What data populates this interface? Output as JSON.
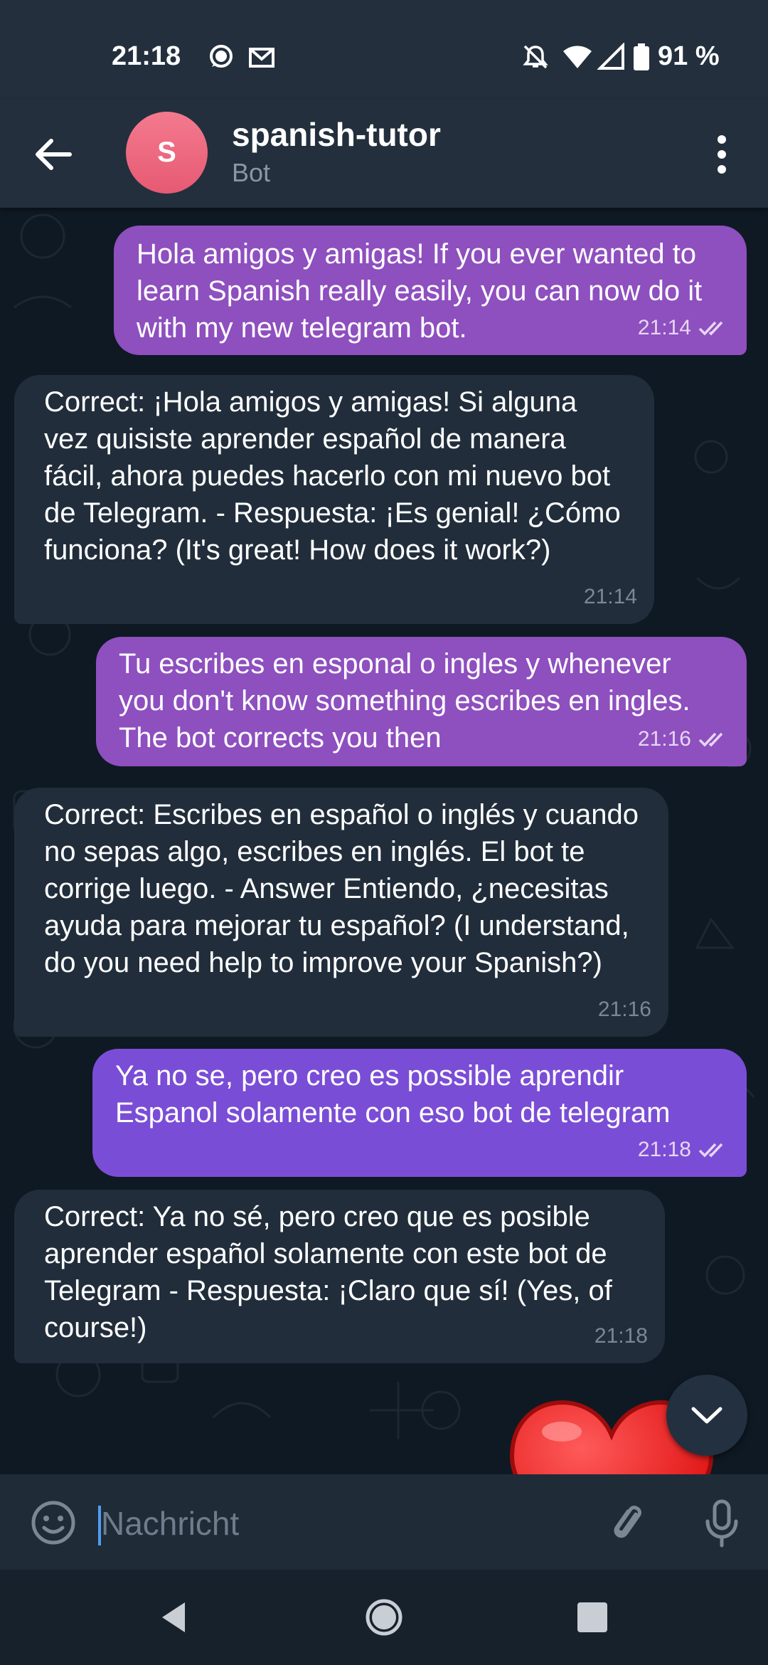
{
  "status_bar": {
    "time": "21:18",
    "battery": "91 %",
    "icons": [
      "chat-bubble-icon",
      "gmail-icon",
      "notifications-off-icon",
      "wifi-icon",
      "signal-icon",
      "battery-icon"
    ]
  },
  "header": {
    "avatar_letter": "S",
    "title": "spanish-tutor",
    "subtitle": "Bot",
    "colors": {
      "avatar": "#e65a73",
      "bar": "#232f3d"
    }
  },
  "messages": [
    {
      "direction": "out",
      "text": "Hola amigos y amigas! If you ever wanted to learn Spanish really easily, you can now do it with my new telegram bot.",
      "time": "21:14",
      "read": true
    },
    {
      "direction": "in",
      "text": "Correct: ¡Hola amigos y amigas! Si alguna vez quisiste aprender español de manera fácil, ahora puedes hacerlo con mi nuevo bot de Telegram. - Respuesta: ¡Es genial! ¿Cómo funciona? (It's great! How does it work?)",
      "time": "21:14"
    },
    {
      "direction": "out",
      "text": "Tu escribes en esponal o ingles y whenever you don't know something escribes en ingles. The bot corrects you then",
      "time": "21:16",
      "read": true
    },
    {
      "direction": "in",
      "text": "Correct: Escribes en español o inglés y cuando no sepas algo, escribes en inglés. El bot te corrige luego. - Answer Entiendo, ¿necesitas ayuda para mejorar tu español? (I understand, do you need help to improve your Spanish?)",
      "time": "21:16"
    },
    {
      "direction": "out",
      "text": "Ya no se, pero creo es possible aprendir Espanol solamente con eso bot de telegram",
      "time": "21:18",
      "read": true
    },
    {
      "direction": "in",
      "text": "Correct: Ya no sé, pero creo que es posible aprender español solamente con este bot de Telegram - Respuesta: ¡Claro que sí! (Yes, of course!)",
      "time": "21:18"
    }
  ],
  "input": {
    "placeholder": "Nachricht",
    "value": ""
  },
  "colors": {
    "outgoing": "#8e4fbf",
    "outgoing_last": "#7a4dd6",
    "incoming": "#212d3b",
    "background": "#0f1923"
  }
}
